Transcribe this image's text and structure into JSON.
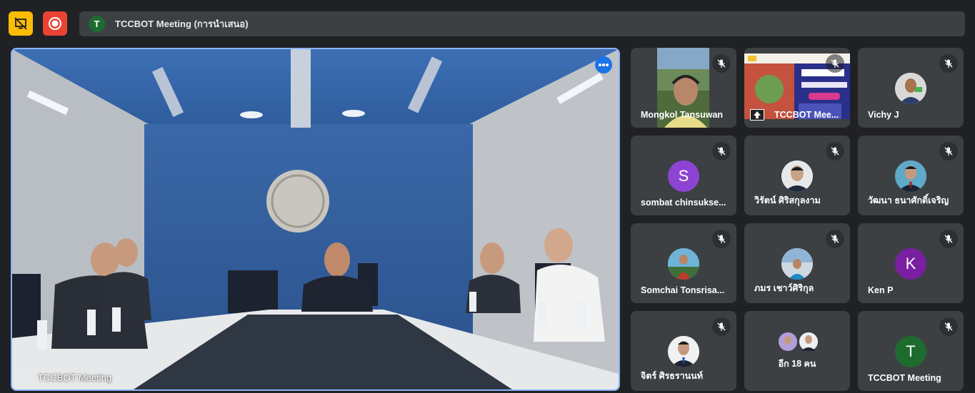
{
  "meeting": {
    "title": "TCCBOT Meeting (การนำเสนอ)",
    "avatar_letter": "T"
  },
  "main_tile": {
    "label": "TCCBOT Meeting"
  },
  "participants": [
    {
      "name": "Mongkol Tansuwan",
      "type": "video"
    },
    {
      "name": "TCCBOT Mee...",
      "type": "presentation"
    },
    {
      "name": "Vichy J",
      "type": "photo"
    },
    {
      "name": "sombat chinsukse...",
      "type": "letter",
      "letter": "S",
      "color": "#8e44d2"
    },
    {
      "name": "วิรัตน์ ศิริสกุลงาม",
      "type": "photo"
    },
    {
      "name": "วัฒนา ธนาศักดิ์เจริญ",
      "type": "photo"
    },
    {
      "name": "Somchai Tonsrisa...",
      "type": "photo"
    },
    {
      "name": "ภมร เชาว์ศิริกุล",
      "type": "photo"
    },
    {
      "name": "Ken P",
      "type": "letter",
      "letter": "K",
      "color": "#7b1fa2"
    },
    {
      "name": "จิตร์ ศิรธรานนท์",
      "type": "photo"
    },
    {
      "name": "อีก 18 คน",
      "type": "others"
    },
    {
      "name": "TCCBOT Meeting",
      "type": "letter",
      "letter": "T",
      "color": "#1e6b2e"
    }
  ],
  "colors": {
    "present_button": "#fbbc04",
    "record_button": "#ea4335",
    "active_speaker_border": "#8ab4f8"
  },
  "icons": [
    "present-off-icon",
    "record-icon",
    "more-options-icon",
    "pin-icon",
    "mic-off-icon"
  ]
}
